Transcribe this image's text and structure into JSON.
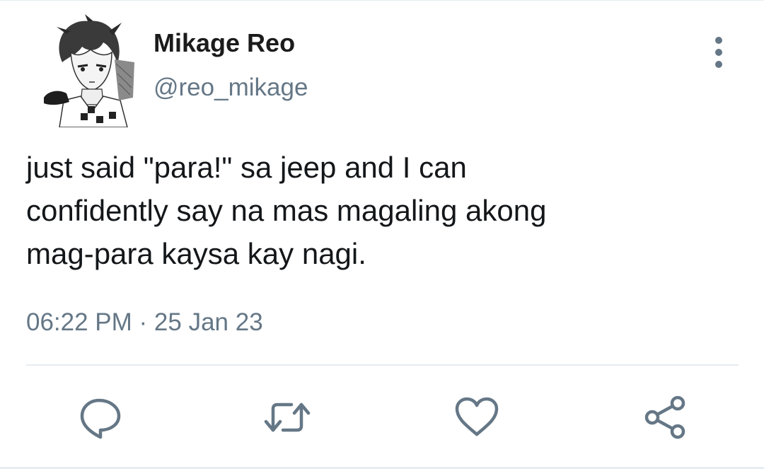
{
  "author": {
    "display_name": "Mikage Reo",
    "handle": "@reo_mikage"
  },
  "tweet": {
    "text": "just said \"para!\" sa jeep and I can\nconfidently say na mas magaling akong\nmag-para kaysa kay nagi.",
    "timestamp": "06:22 PM · 25 Jan 23"
  },
  "icons": {
    "more": "vertical-ellipsis-icon",
    "reply": "speech-bubble-icon",
    "retweet": "retweet-arrows-icon",
    "like": "heart-icon",
    "share": "share-nodes-icon"
  },
  "colors": {
    "text": "#14171a",
    "secondary": "#657786",
    "divider": "#e6ecf0"
  }
}
